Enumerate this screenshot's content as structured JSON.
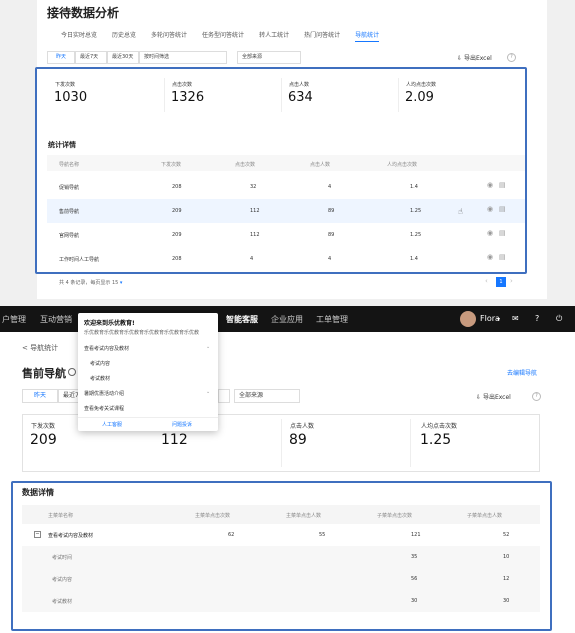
{
  "top": {
    "title": "接待数据分析",
    "tabs": [
      "今日实时总览",
      "历史总览",
      "多轮问答统计",
      "任务型问答统计",
      "转人工统计",
      "热门问答统计",
      "导航统计"
    ],
    "filters": {
      "yesterday": "昨天",
      "last7": "最近7天",
      "last30": "最近30天",
      "time_select": "按时间筛选",
      "source": "全部来源"
    },
    "export": "导出Excel",
    "help": "?",
    "stats": [
      {
        "label": "下发次数",
        "value": "1030"
      },
      {
        "label": "点击次数",
        "value": "1326"
      },
      {
        "label": "点击人数",
        "value": "634"
      },
      {
        "label": "人均点击次数",
        "value": "2.09"
      }
    ],
    "section": "统计详情",
    "headers": [
      "导航名称",
      "下发次数",
      "点击次数",
      "点击人数",
      "人均点击次数"
    ],
    "rows": [
      [
        "促销导航",
        "208",
        "32",
        "4",
        "1.4"
      ],
      [
        "售前导航",
        "209",
        "112",
        "89",
        "1.25"
      ],
      [
        "官网导航",
        "209",
        "112",
        "89",
        "1.25"
      ],
      [
        "工作时间人工导航",
        "208",
        "4",
        "4",
        "1.4"
      ]
    ],
    "pagination": "共 4 条记录，每页显示 15",
    "page": "1"
  },
  "bottom": {
    "nav": {
      "item1": "户管理",
      "item2": "互动营销",
      "item3": "智能客服",
      "item4": "企业应用",
      "item5": "工单管理",
      "user": "Flora",
      "caret": "▾"
    },
    "breadcrumb": "< 导航统计",
    "title": "售前导航",
    "edit_link": "去编辑导航",
    "filters": {
      "yesterday": "昨天",
      "last7": "最近7",
      "source": "全部来源"
    },
    "export": "导出Excel",
    "help": "?",
    "stats": [
      {
        "label": "下发次数",
        "value": "209"
      },
      {
        "label": "",
        "value": "112"
      },
      {
        "label": "点击人数",
        "value": "89"
      },
      {
        "label": "人均点击次数",
        "value": "1.25"
      }
    ],
    "section": "数据详情",
    "headers": [
      "主菜单名称",
      "主菜单点击次数",
      "主菜单点击人数",
      "子菜单点击次数",
      "子菜单点击人数"
    ],
    "rows": [
      [
        "查看考试内容及教材",
        "62",
        "55",
        "121",
        "52"
      ],
      [
        "考试时间",
        "",
        "",
        "35",
        "10"
      ],
      [
        "考试内容",
        "",
        "",
        "56",
        "12"
      ],
      [
        "考试教材",
        "",
        "",
        "30",
        "30"
      ]
    ],
    "dropdown": {
      "title": "欢迎来到乐优教育!",
      "subtitle": "乐优教育乐优教育乐优教育乐优教育乐优教育乐优教",
      "items": [
        "查看考试内容及教材",
        "考试内容",
        "考试教材",
        "暑期优惠活动介绍",
        "查看免考关试课程"
      ],
      "btn1": "人工客服",
      "btn2": "问题投诉"
    }
  }
}
